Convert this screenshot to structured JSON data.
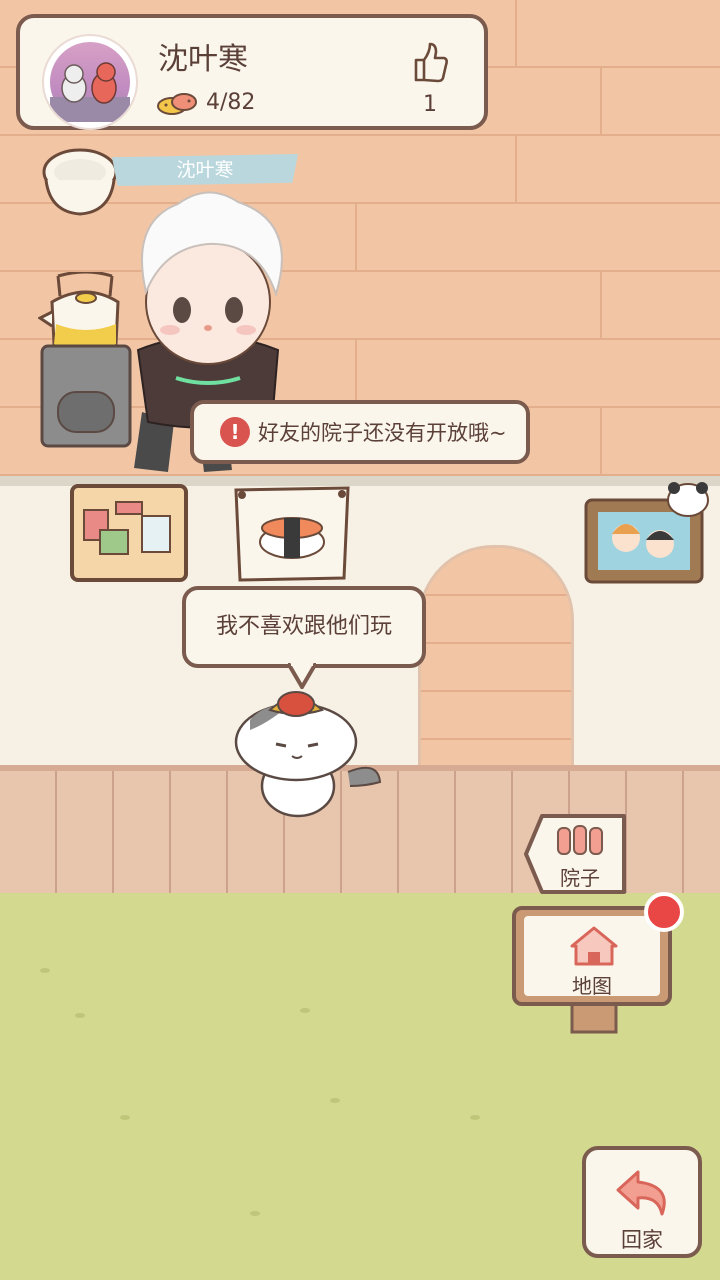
{
  "profile": {
    "name": "沈叶寒",
    "fish_count": "4/82",
    "likes": "1"
  },
  "name_banner": "沈叶寒",
  "toast": {
    "message": "好友的院子还没有开放哦~",
    "icon": "alert-icon"
  },
  "speech_bubble": "我不喜欢跟他们玩",
  "buttons": {
    "yard": "院子",
    "map": "地图",
    "home": "回家"
  },
  "colors": {
    "accent_brown": "#7b5b4e",
    "notification_red": "#e94646",
    "card_bg": "#fbf6ec"
  }
}
